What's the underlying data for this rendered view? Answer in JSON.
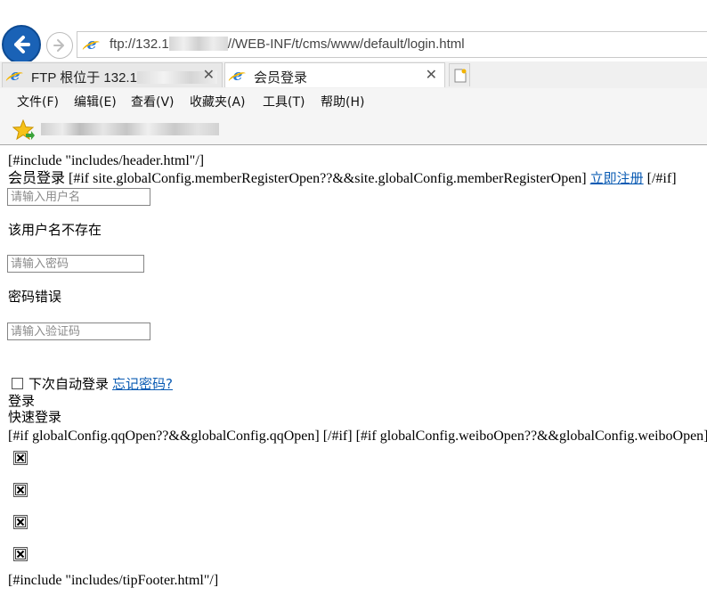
{
  "browser": {
    "address_prefix": "ftp://132.1",
    "address_suffix": "//WEB-INF/t/cms/www/default/login.html",
    "tabs": [
      {
        "label": "FTP 根位于 132.1",
        "close": "✕",
        "active": false
      },
      {
        "label": "会员登录",
        "close": "✕",
        "active": true
      }
    ],
    "menu": [
      "文件(F)",
      "编辑(E)",
      "查看(V)",
      "收藏夹(A)",
      "工具(T)",
      "帮助(H)"
    ]
  },
  "page": {
    "include_header": "[#include \"includes/header.html\"/]",
    "login_line_text": "会员登录 [#if site.globalConfig.memberRegisterOpen??&&site.globalConfig.memberRegisterOpen] ",
    "register_link": "立即注册",
    "login_line_after": " [/#if]",
    "username_placeholder": "请输入用户名",
    "username_error": "该用户名不存在",
    "password_placeholder": "请输入密码",
    "password_error": "密码错误",
    "captcha_placeholder": "请输入验证码",
    "remember_label": "下次自动登录",
    "forgot_link": "忘记密码?",
    "login_button": "登录",
    "quick_login": "快速登录",
    "oauth_conditions": "[#if globalConfig.qqOpen??&&globalConfig.qqOpen] [/#if] [#if globalConfig.weiboOpen??&&globalConfig.weiboOpen] [/#if]",
    "include_footer": "[#include \"includes/tipFooter.html\"/]"
  }
}
